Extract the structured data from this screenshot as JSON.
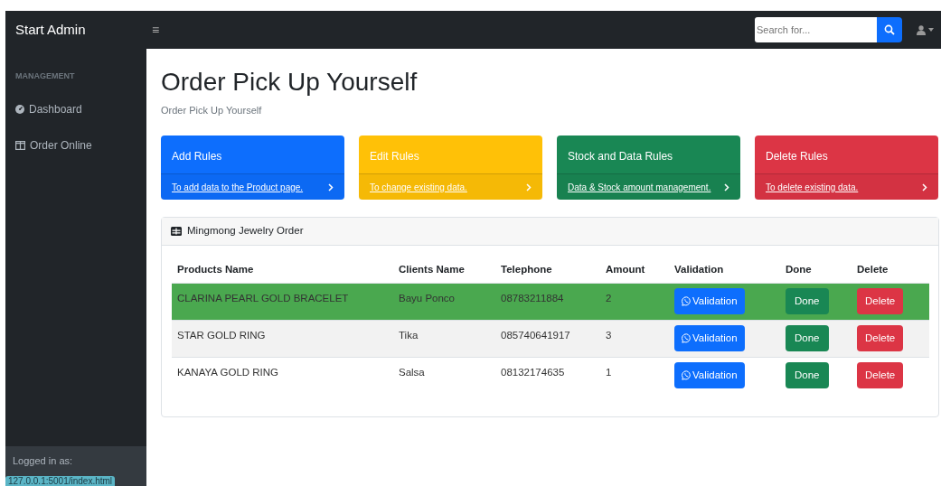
{
  "brand": "Start Admin",
  "menu_toggle": "≡",
  "search": {
    "placeholder": "Search for..."
  },
  "sidebar": {
    "heading": "MANAGEMENT",
    "items": [
      {
        "label": "Dashboard",
        "kind": "gauge"
      },
      {
        "label": "Order Online",
        "kind": "columns"
      }
    ],
    "footer_label": "Logged in as:"
  },
  "page": {
    "title": "Order Pick Up Yourself",
    "breadcrumb": "Order Pick Up Yourself"
  },
  "cards": [
    {
      "title": "Add Rules",
      "link": "To add data to the Product page.",
      "color": "#0d6efd"
    },
    {
      "title": "Edit Rules",
      "link": "To change existing data.",
      "color": "#ffc107"
    },
    {
      "title": "Stock and Data Rules",
      "link": "Data & Stock amount management.",
      "color": "#198754"
    },
    {
      "title": "Delete Rules",
      "link": "To delete existing data.",
      "color": "#dc3545"
    }
  ],
  "table": {
    "title": "Mingmong Jewelry Order",
    "columns": [
      "Products Name",
      "Clients Name",
      "Telephone",
      "Amount",
      "Validation",
      "Done",
      "Delete"
    ],
    "rows": [
      {
        "product": "CLARINA PEARL GOLD BRACELET",
        "client": "Bayu Ponco",
        "telephone": "08783211884",
        "amount": "2",
        "validation": "Validation",
        "done": "Done",
        "delete": "Delete",
        "highlighted": true
      },
      {
        "product": "STAR GOLD RING",
        "client": "Tika",
        "telephone": "085740641917",
        "amount": "3",
        "validation": "Validation",
        "done": "Done",
        "delete": "Delete",
        "highlighted": false
      },
      {
        "product": "KANAYA GOLD RING",
        "client": "Salsa",
        "telephone": "08132174635",
        "amount": "1",
        "validation": "Validation",
        "done": "Done",
        "delete": "Delete",
        "highlighted": false
      }
    ]
  },
  "status_url": "127.0.0.1:5001/index.html"
}
